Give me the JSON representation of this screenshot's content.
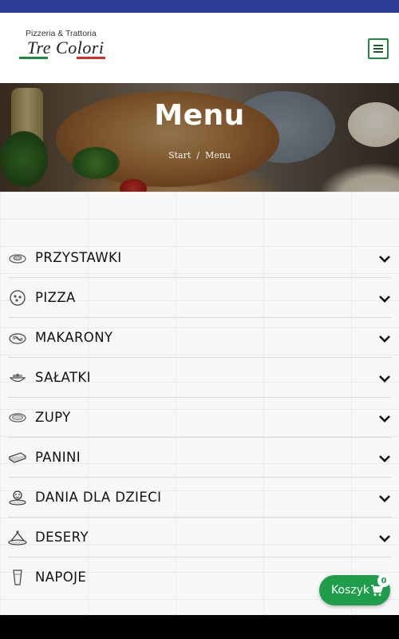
{
  "header": {
    "logo_top": "Pizzeria & Trattoria",
    "logo_name": "Tre Colori",
    "flag_colors": [
      "#1e8a3e",
      "#ffffff",
      "#d42b2b"
    ],
    "menu_icon": "hamburger-icon"
  },
  "hero": {
    "title": "Menu",
    "breadcrumb": {
      "home": "Start",
      "separator": "/",
      "current": "Menu"
    }
  },
  "categories": [
    {
      "label": "PRZYSTAWKI",
      "icon": "appetizer-icon"
    },
    {
      "label": "PIZZA",
      "icon": "pizza-icon"
    },
    {
      "label": "MAKARONY",
      "icon": "pasta-icon"
    },
    {
      "label": "SAŁATKI",
      "icon": "salad-icon"
    },
    {
      "label": "ZUPY",
      "icon": "soup-icon"
    },
    {
      "label": "PANINI",
      "icon": "panini-icon"
    },
    {
      "label": "DANIA DLA DZIECI",
      "icon": "kids-meal-icon"
    },
    {
      "label": "DESERY",
      "icon": "dessert-icon"
    },
    {
      "label": "NAPOJE",
      "icon": "drink-icon"
    }
  ],
  "cart": {
    "label": "Koszyk",
    "count": "0",
    "icon": "cart-icon"
  },
  "colors": {
    "topbar": "#2b3d97",
    "accent_green": "#1f9d4a"
  }
}
